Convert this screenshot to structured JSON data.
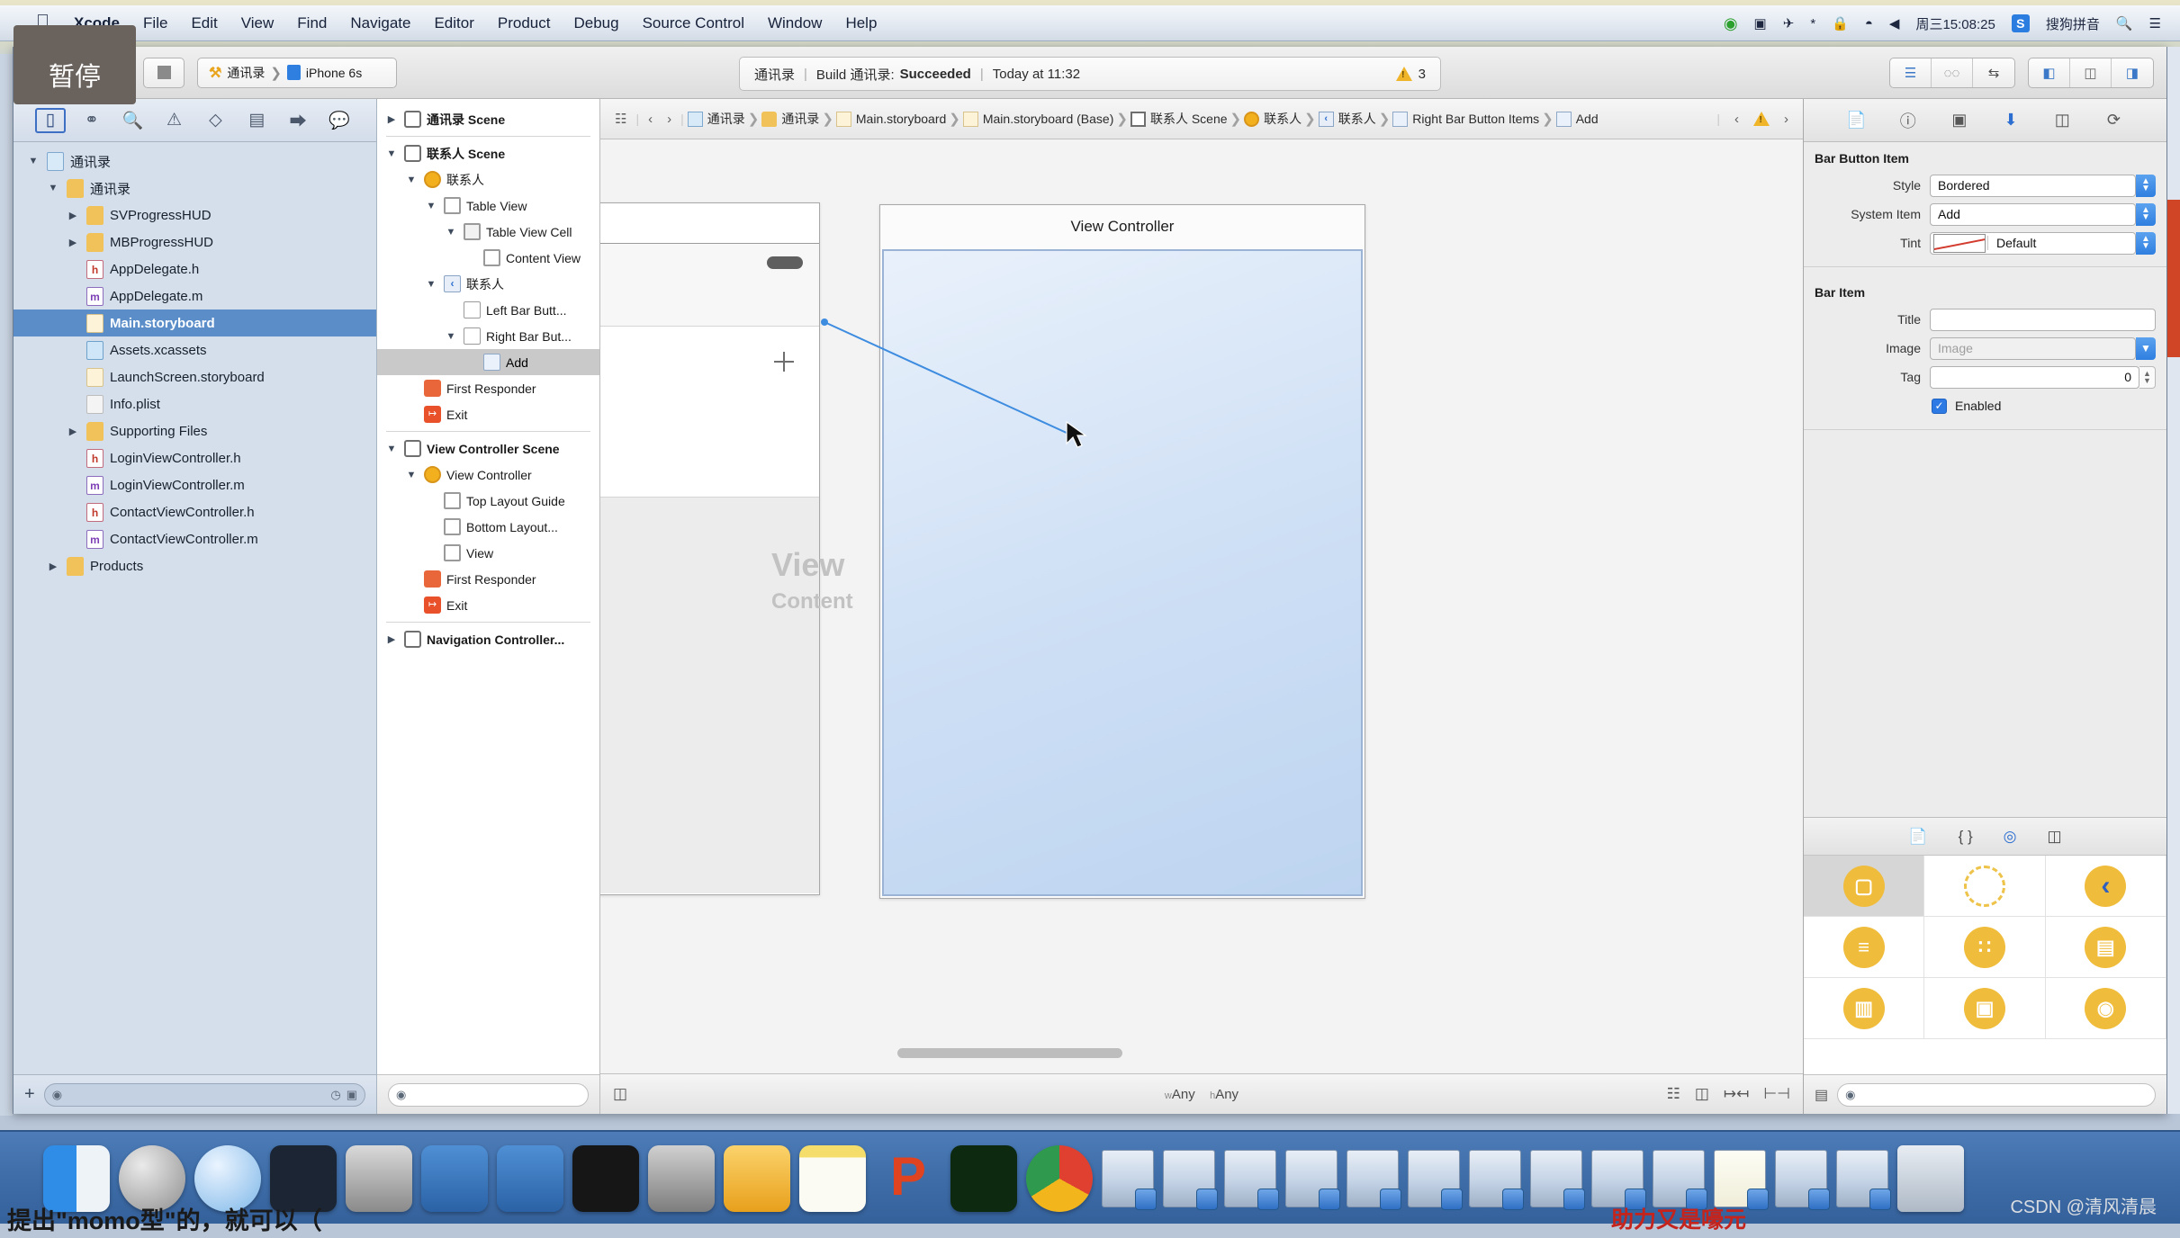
{
  "menubar": {
    "apple": "",
    "items": [
      "Xcode",
      "File",
      "Edit",
      "View",
      "Find",
      "Navigate",
      "Editor",
      "Product",
      "Debug",
      "Source Control",
      "Window",
      "Help"
    ],
    "status_items": [
      "⦿",
      "◨",
      "✈",
      "✲",
      "⬔",
      "◗",
      "◀"
    ],
    "clock": "周三15:08:25",
    "input_method": "搜狗拼音",
    "search_icon": "search-icon",
    "list_icon": "list-icon"
  },
  "toolbar": {
    "pause_tooltip": "暂停",
    "run_label": "run-button",
    "stop_label": "stop-button",
    "scheme_project": "通讯录",
    "scheme_device": "iPhone 6s",
    "status_project": "通讯录",
    "status_build": "Build 通讯录:",
    "status_result": "Succeeded",
    "status_time": "Today at 11:32",
    "warning_count": "3"
  },
  "navigator": {
    "tabs": [
      "folder-icon",
      "relations-icon",
      "search-icon",
      "warning-icon",
      "test-icon",
      "debug-icon",
      "breakpoint-icon",
      "report-icon"
    ],
    "tree": [
      {
        "label": "通讯录",
        "depth": 0,
        "disc": "▼",
        "icon": "f-proj",
        "bold": true
      },
      {
        "label": "通讯录",
        "depth": 1,
        "disc": "▼",
        "icon": "f-folder"
      },
      {
        "label": "SVProgressHUD",
        "depth": 2,
        "disc": "▶",
        "icon": "f-folder"
      },
      {
        "label": "MBProgressHUD",
        "depth": 2,
        "disc": "▶",
        "icon": "f-folder"
      },
      {
        "label": "AppDelegate.h",
        "depth": 2,
        "disc": "",
        "icon": "f-h",
        "glyph": "h"
      },
      {
        "label": "AppDelegate.m",
        "depth": 2,
        "disc": "",
        "icon": "f-m",
        "glyph": "m"
      },
      {
        "label": "Main.storyboard",
        "depth": 2,
        "disc": "",
        "icon": "f-sb",
        "selected": true
      },
      {
        "label": "Assets.xcassets",
        "depth": 2,
        "disc": "",
        "icon": "f-xc"
      },
      {
        "label": "LaunchScreen.storyboard",
        "depth": 2,
        "disc": "",
        "icon": "f-sb"
      },
      {
        "label": "Info.plist",
        "depth": 2,
        "disc": "",
        "icon": "f-pl"
      },
      {
        "label": "Supporting Files",
        "depth": 2,
        "disc": "▶",
        "icon": "f-folder"
      },
      {
        "label": "LoginViewController.h",
        "depth": 2,
        "disc": "",
        "icon": "f-h",
        "glyph": "h"
      },
      {
        "label": "LoginViewController.m",
        "depth": 2,
        "disc": "",
        "icon": "f-m",
        "glyph": "m"
      },
      {
        "label": "ContactViewController.h",
        "depth": 2,
        "disc": "",
        "icon": "f-h",
        "glyph": "h"
      },
      {
        "label": "ContactViewController.m",
        "depth": 2,
        "disc": "",
        "icon": "f-m",
        "glyph": "m"
      },
      {
        "label": "Products",
        "depth": 1,
        "disc": "▶",
        "icon": "f-folder"
      }
    ],
    "filter_placeholder": "",
    "add_button": "+"
  },
  "outline": {
    "tree": [
      {
        "label": "通讯录 Scene",
        "depth": 0,
        "disc": "▶",
        "icon": "o-scene",
        "bold": true
      },
      {
        "sep": true
      },
      {
        "label": "联系人 Scene",
        "depth": 0,
        "disc": "▼",
        "icon": "o-scene",
        "bold": true
      },
      {
        "label": "联系人",
        "depth": 1,
        "disc": "▼",
        "icon": "o-vc"
      },
      {
        "label": "Table View",
        "depth": 2,
        "disc": "▼",
        "icon": "o-view"
      },
      {
        "label": "Table View Cell",
        "depth": 3,
        "disc": "▼",
        "icon": "o-cell"
      },
      {
        "label": "Content View",
        "depth": 4,
        "disc": "",
        "icon": "o-view"
      },
      {
        "label": "联系人",
        "depth": 2,
        "disc": "▼",
        "icon": "o-nav",
        "glyph": "‹"
      },
      {
        "label": "Left Bar Butt...",
        "depth": 3,
        "disc": "",
        "icon": "o-bar"
      },
      {
        "label": "Right Bar But...",
        "depth": 3,
        "disc": "▼",
        "icon": "o-bar"
      },
      {
        "label": "Add",
        "depth": 4,
        "disc": "",
        "icon": "o-add",
        "selected": true
      },
      {
        "label": "First Responder",
        "depth": 1,
        "disc": "",
        "icon": "o-resp"
      },
      {
        "label": "Exit",
        "depth": 1,
        "disc": "",
        "icon": "o-exit",
        "glyph": "↦"
      },
      {
        "sep": true
      },
      {
        "label": "View Controller Scene",
        "depth": 0,
        "disc": "▼",
        "icon": "o-scene",
        "bold": true
      },
      {
        "label": "View Controller",
        "depth": 1,
        "disc": "▼",
        "icon": "o-vc"
      },
      {
        "label": "Top Layout Guide",
        "depth": 2,
        "disc": "",
        "icon": "o-view"
      },
      {
        "label": "Bottom Layout...",
        "depth": 2,
        "disc": "",
        "icon": "o-view"
      },
      {
        "label": "View",
        "depth": 2,
        "disc": "",
        "icon": "o-view"
      },
      {
        "label": "First Responder",
        "depth": 1,
        "disc": "",
        "icon": "o-resp"
      },
      {
        "label": "Exit",
        "depth": 1,
        "disc": "",
        "icon": "o-exit",
        "glyph": "↦"
      },
      {
        "sep": true
      },
      {
        "label": "Navigation Controller...",
        "depth": 0,
        "disc": "▶",
        "icon": "o-scene",
        "bold": true
      }
    ],
    "filter_placeholder": ""
  },
  "breadcrumb": {
    "items": [
      {
        "label": "通讯录",
        "icon": "project-icon"
      },
      {
        "label": "通讯录",
        "icon": "folder-icon"
      },
      {
        "label": "Main.storyboard",
        "icon": "storyboard-icon"
      },
      {
        "label": "Main.storyboard (Base)",
        "icon": "storyboard-icon"
      },
      {
        "label": "联系人 Scene",
        "icon": "scene-icon"
      },
      {
        "label": "联系人",
        "icon": "viewcontroller-icon"
      },
      {
        "label": "联系人",
        "icon": "navbar-icon"
      },
      {
        "label": "Right Bar Button Items",
        "icon": "baritem-icon"
      },
      {
        "label": "Add",
        "icon": "baritem-icon"
      }
    ],
    "back_arrow": "‹",
    "fwd_arrow": "›"
  },
  "canvas": {
    "right_scene_title": "View Controller",
    "ghost_view": "View",
    "ghost_content": "Content"
  },
  "editor_bottom": {
    "size_class_w_prefix": "w",
    "size_class_w": "Any",
    "size_class_h_prefix": "h",
    "size_class_h": "Any",
    "tools": [
      "nesting-icon",
      "align-icon",
      "pin-icon",
      "resolve-icon"
    ]
  },
  "inspector": {
    "tabs": [
      "file-inspector-icon",
      "quick-help-icon",
      "identity-inspector-icon",
      "attributes-inspector-icon",
      "size-inspector-icon",
      "connections-inspector-icon"
    ],
    "active_tab_index": 3,
    "section_bar_button_item": "Bar Button Item",
    "style_label": "Style",
    "style_value": "Bordered",
    "system_item_label": "System Item",
    "system_item_value": "Add",
    "tint_label": "Tint",
    "tint_value": "Default",
    "section_bar_item": "Bar Item",
    "title_label": "Title",
    "title_value": "",
    "image_label": "Image",
    "image_placeholder": "Image",
    "tag_label": "Tag",
    "tag_value": "0",
    "enabled_label": "Enabled",
    "enabled_checked": true,
    "accent_color": "#2d7ae5"
  },
  "library": {
    "tabs": [
      "file-template-icon",
      "code-snippet-icon",
      "object-library-icon",
      "media-library-icon"
    ],
    "active_tab_index": 2,
    "items": [
      {
        "name": "view-controller-object",
        "selected": true
      },
      {
        "name": "storyboard-reference-object",
        "selected": false
      },
      {
        "name": "navigation-controller-object",
        "selected": false
      },
      {
        "name": "table-view-controller-object",
        "selected": false
      },
      {
        "name": "collection-view-controller-object",
        "selected": false
      },
      {
        "name": "tab-bar-controller-object",
        "selected": false
      },
      {
        "name": "split-view-controller-object",
        "selected": false
      },
      {
        "name": "page-view-controller-object",
        "selected": false
      },
      {
        "name": "glkit-view-controller-object",
        "selected": false
      }
    ],
    "filter_placeholder": ""
  },
  "dock": {
    "apps": [
      "finder",
      "launchpad",
      "safari",
      "mouse",
      "quicktime",
      "xcode",
      "xcode-device",
      "terminal",
      "system-preferences",
      "sketch",
      "notes",
      "p-app",
      "exec",
      "chrome"
    ],
    "windows_count": 12,
    "trash": "trash-icon"
  },
  "overlay": {
    "watermark": "CSDN @清风清晨",
    "bottom_left_text": "提出\"momo型\"的，就可以（",
    "bottom_right_text": "助力又是嚎元"
  }
}
